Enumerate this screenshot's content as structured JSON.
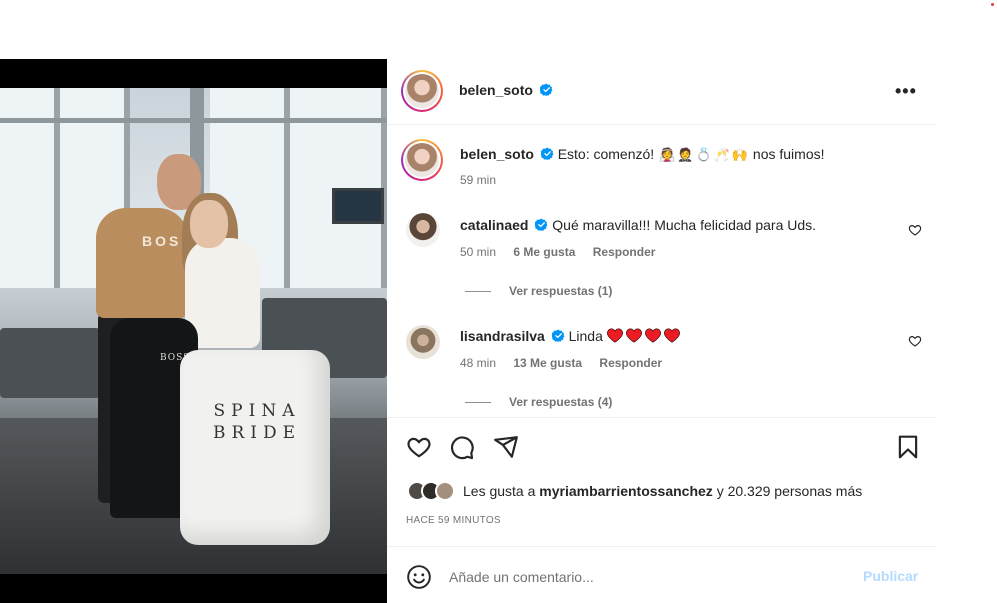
{
  "post": {
    "author": "belen_soto",
    "caption_author": "belen_soto",
    "caption_text": "Esto: comenzó!",
    "caption_emojis": [
      "👰",
      "🤵",
      "💍",
      "🥂",
      "🙌"
    ],
    "caption_tail": "nos fuimos!",
    "caption_time": "59 min",
    "more_label": "•••",
    "photo_text": {
      "bag": "SPINA BRIDE",
      "hoodie": "BOSS",
      "garment_bag": "BOSS"
    }
  },
  "comments": [
    {
      "username": "catalinaed",
      "text": "Qué maravilla!!! Mucha felicidad para Uds.",
      "hearts": 0,
      "time": "50 min",
      "likes": "6 Me gusta",
      "reply": "Responder",
      "view_replies": "Ver respuestas (1)"
    },
    {
      "username": "lisandrasilva",
      "text": "Linda",
      "hearts": 4,
      "time": "48 min",
      "likes": "13 Me gusta",
      "reply": "Responder",
      "view_replies": "Ver respuestas (4)"
    }
  ],
  "likes": {
    "prefix": "Les gusta a",
    "user": "myriambarrientossanchez",
    "suffix": "y 20.329 personas más"
  },
  "timestamp": "HACE 59 MINUTOS",
  "comment_box": {
    "placeholder": "Añade un comentario...",
    "publish": "Publicar"
  },
  "colors": {
    "verified": "#0095f6",
    "heart_red": "#ed1c24",
    "publish_disabled": "#b3dbff",
    "muted_text": "#737373"
  }
}
